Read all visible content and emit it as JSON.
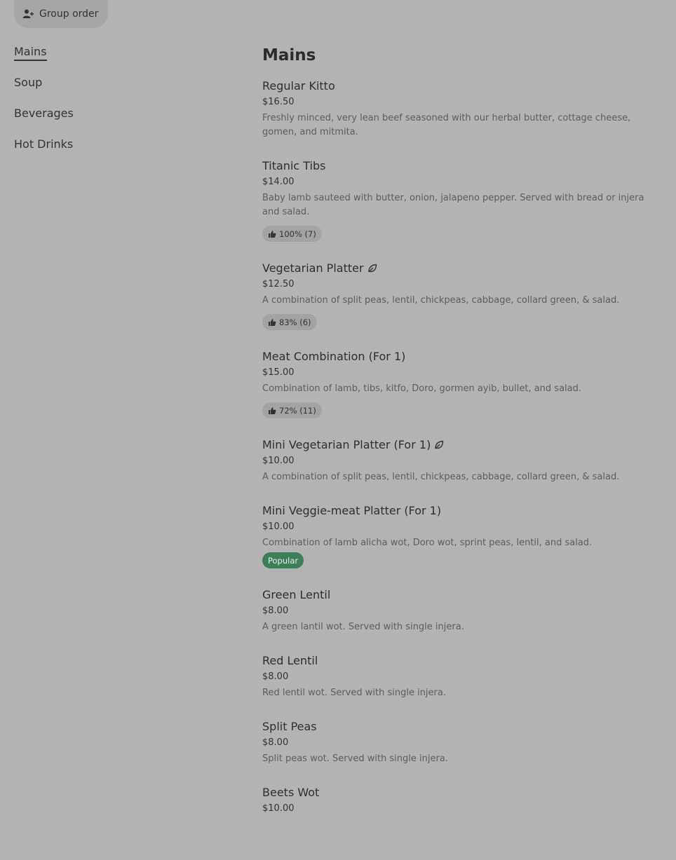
{
  "header": {
    "group_order_label": "Group order"
  },
  "sidebar": {
    "items": [
      {
        "label": "Mains",
        "active": true
      },
      {
        "label": "Soup",
        "active": false
      },
      {
        "label": "Beverages",
        "active": false
      },
      {
        "label": "Hot Drinks",
        "active": false
      }
    ]
  },
  "main": {
    "section_title": "Mains",
    "items": [
      {
        "name": "Regular Kitto",
        "price": "$16.50",
        "desc": "Freshly minced, very lean beef seasoned with our herbal butter, cottage cheese, gomen, and mitmita."
      },
      {
        "name": "Titanic Tibs",
        "price": "$14.00",
        "desc": "Baby lamb sauteed with butter, onion, jalapeno pepper. Served with bread or injera and salad.",
        "rating": "100% (7)"
      },
      {
        "name": "Vegetarian Platter",
        "price": "$12.50",
        "desc": "A combination of split peas, lentil, chickpeas, cabbage, collard green, & salad.",
        "rating": "83% (6)",
        "vegetarian": true
      },
      {
        "name": "Meat Combination (For 1)",
        "price": "$15.00",
        "desc": "Combination of lamb, tibs, kitfo, Doro, gormen ayib, bullet, and salad.",
        "rating": "72% (11)"
      },
      {
        "name": "Mini Vegetarian Platter (For 1)",
        "price": "$10.00",
        "desc": "A combination of split peas, lentil, chickpeas, cabbage, collard green, & salad.",
        "vegetarian": true
      },
      {
        "name": "Mini Veggie-meat Platter (For 1)",
        "price": "$10.00",
        "desc": "Combination of lamb alicha wot, Doro wot, sprint peas, lentil, and salad.",
        "tag": "Popular"
      },
      {
        "name": "Green Lentil",
        "price": "$8.00",
        "desc": "A green lantil wot. Served with single injera."
      },
      {
        "name": "Red Lentil",
        "price": "$8.00",
        "desc": "Red lentil wot. Served with single injera."
      },
      {
        "name": "Split Peas",
        "price": "$8.00",
        "desc": "Split peas wot. Served with single injera."
      },
      {
        "name": "Beets Wot",
        "price": "$10.00",
        "desc": ""
      }
    ]
  }
}
